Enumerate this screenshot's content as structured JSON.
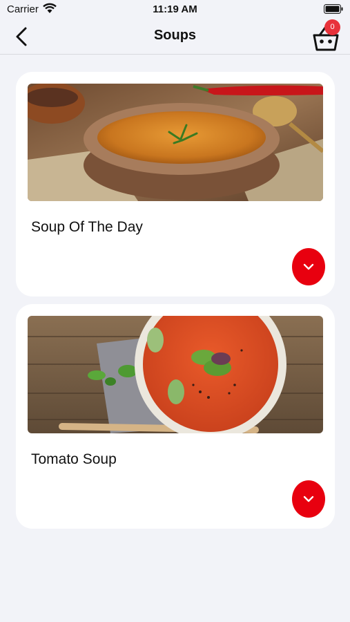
{
  "status_bar": {
    "carrier": "Carrier",
    "time": "11:19 AM"
  },
  "nav": {
    "title": "Soups",
    "cart_count": "0"
  },
  "items": [
    {
      "title": "Soup Of The Day"
    },
    {
      "title": "Tomato Soup"
    }
  ],
  "colors": {
    "accent": "#e8000f",
    "badge": "#e8323b",
    "background": "#f2f3f8"
  }
}
